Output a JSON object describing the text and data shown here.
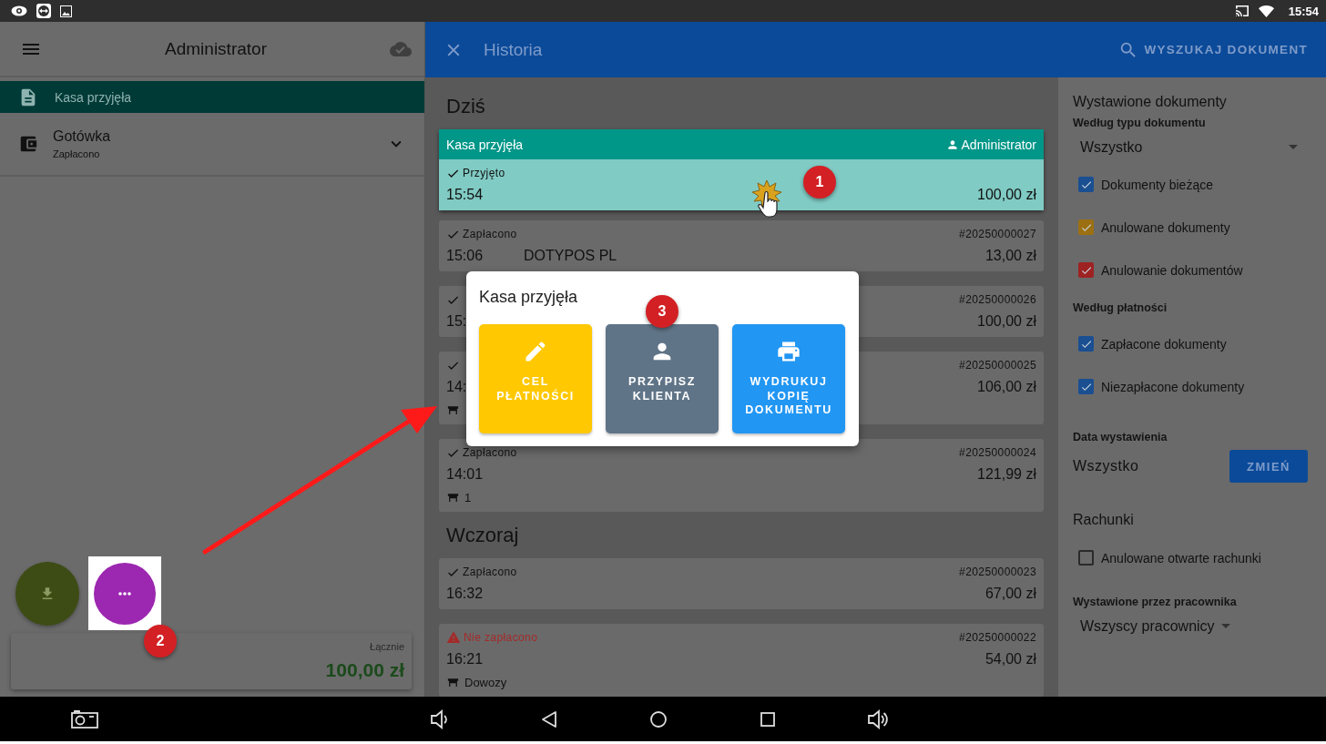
{
  "status_bar": {
    "time": "15:54"
  },
  "left_panel": {
    "title": "Administrator",
    "items": [
      {
        "kind": "document",
        "label": "Kasa przyjęła",
        "selected": true
      },
      {
        "kind": "payment",
        "label": "Gotówka",
        "sublabel": "Zapłacono",
        "selected": false,
        "expanded": false
      }
    ],
    "total": {
      "label": "Łącznie",
      "amount": "100,00 zł"
    }
  },
  "header": {
    "title": "Historia",
    "search": "WYSZUKAJ DOKUMENT"
  },
  "sections": [
    {
      "title": "Dziś",
      "documents": [
        {
          "kind": "expanded",
          "selected": true,
          "header": "Kasa przyjęła",
          "user": "Administrator",
          "status": {
            "kind": "ok",
            "text": "Przyjęto"
          },
          "time": "15:54",
          "amount": "100,00 zł"
        },
        {
          "kind": "normal",
          "selected": false,
          "status": {
            "kind": "ok",
            "text": "Zapłacono"
          },
          "number": "#20250000027",
          "time": "15:06",
          "customer": "DOTYPOS  PL",
          "amount": "13,00 zł"
        },
        {
          "kind": "normal",
          "selected": false,
          "status": {
            "kind": "ok"
          },
          "number": "#20250000026",
          "time": "15:",
          "amount": "100,00 zł"
        },
        {
          "kind": "normal",
          "selected": false,
          "status": {
            "kind": "ok"
          },
          "number": "#20250000025",
          "time": "14:",
          "amount": "106,00 zł",
          "has_table": true
        },
        {
          "kind": "normal",
          "selected": false,
          "status": {
            "kind": "ok",
            "text": "Zapłacono"
          },
          "number": "#20250000024",
          "time": "14:01",
          "amount": "121,99 zł",
          "has_table": true,
          "table": "1"
        }
      ]
    },
    {
      "title": "Wczoraj",
      "documents": [
        {
          "kind": "normal",
          "selected": false,
          "status": {
            "kind": "ok",
            "text": "Zapłacono"
          },
          "number": "#20250000023",
          "time": "16:32",
          "amount": "67,00 zł"
        },
        {
          "kind": "normal",
          "selected": false,
          "status": {
            "kind": "warning",
            "text": "Nie zapłacono"
          },
          "number": "#20250000022",
          "time": "16:21",
          "amount": "54,00 zł",
          "has_table": true,
          "table": "Dowozy"
        }
      ]
    }
  ],
  "filters": {
    "title": "Wystawione dokumenty",
    "type_group": {
      "heading": "Według typu dokumentu",
      "dropdown": "Wszystko",
      "checkboxes": [
        {
          "label": "Dokumenty bieżące",
          "checked": true,
          "color": "#1a4f91"
        },
        {
          "label": "Anulowane dokumenty",
          "checked": true,
          "color": "#9c7012"
        },
        {
          "label": "Anulowanie dokumentów",
          "checked": true,
          "color": "#9e2222"
        }
      ]
    },
    "payment_group": {
      "heading": "Według płatności",
      "checkboxes": [
        {
          "label": "Zapłacone dokumenty",
          "checked": true,
          "color": "#1a4f91"
        },
        {
          "label": "Niezapłacone dokumenty",
          "checked": true,
          "color": "#1a4f91"
        }
      ]
    },
    "date": {
      "heading": "Data wystawienia",
      "value": "Wszystko",
      "button": "ZMIEŃ"
    },
    "bills": {
      "heading": "Rachunki",
      "checkboxes": [
        {
          "label": "Anulowane otwarte rachunki",
          "checked": false
        }
      ]
    },
    "employee": {
      "heading": "Wystawione przez pracownika",
      "dropdown": "Wszyscy pracownicy"
    }
  },
  "dialog": {
    "title": "Kasa przyjęła",
    "actions": [
      {
        "kind": "edit",
        "label": "CEL PŁATNOŚCI",
        "color": "#ffc800"
      },
      {
        "kind": "person",
        "label": "PRZYPISZ KLIENTA",
        "color": "#607487"
      },
      {
        "kind": "print",
        "label": "WYDRUKUJ KOPIĘ DOKUMENTU",
        "color": "#2196f3"
      }
    ]
  },
  "annotations": [
    "1",
    "2",
    "3"
  ]
}
